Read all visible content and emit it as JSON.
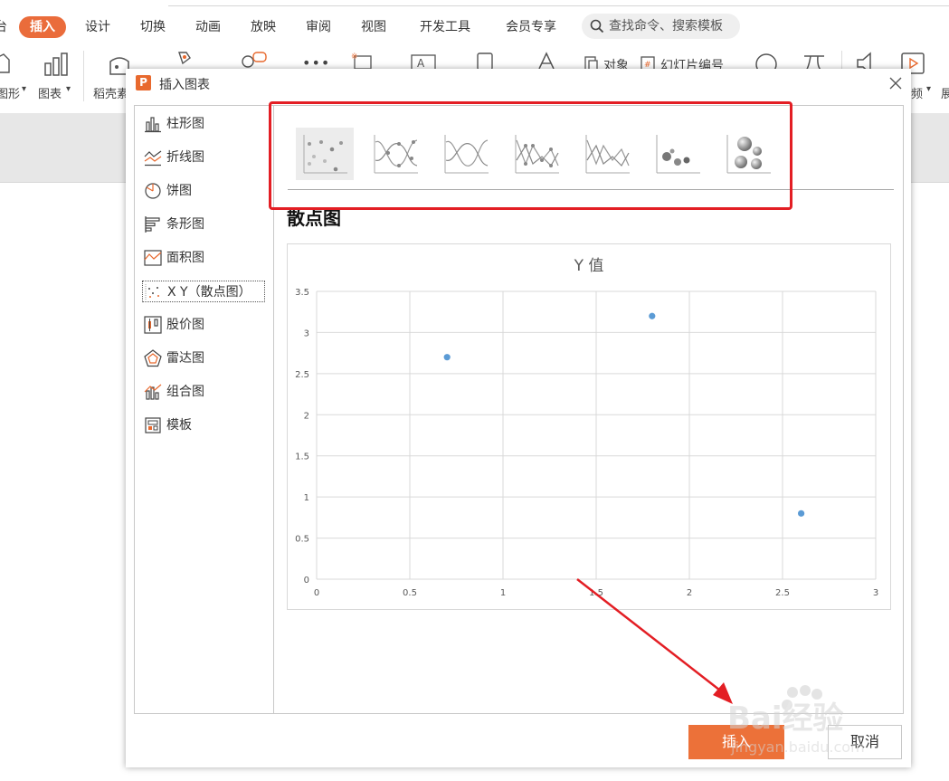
{
  "ribbon": {
    "tabs": [
      {
        "label": "插入",
        "active": true
      },
      {
        "label": "设计",
        "active": false
      },
      {
        "label": "切换",
        "active": false
      },
      {
        "label": "动画",
        "active": false
      },
      {
        "label": "放映",
        "active": false
      },
      {
        "label": "审阅",
        "active": false
      },
      {
        "label": "视图",
        "active": false
      },
      {
        "label": "开发工具",
        "active": false
      },
      {
        "label": "会员专享",
        "active": false
      }
    ],
    "search_placeholder": "查找命令、搜索模板",
    "buttons": {
      "shape": "图形",
      "chart": "图表",
      "daoke": "稻壳素",
      "object": "对象",
      "slide_number": "幻灯片编号",
      "video": "频",
      "more": "展"
    },
    "accent_color": "#ea6c3b"
  },
  "dialog": {
    "title": "插入图表",
    "logo_letter": "P",
    "sidebar": [
      {
        "label": "柱形图",
        "icon": "column-chart-icon",
        "selected": false
      },
      {
        "label": "折线图",
        "icon": "line-chart-icon",
        "selected": false
      },
      {
        "label": "饼图",
        "icon": "pie-chart-icon",
        "selected": false
      },
      {
        "label": "条形图",
        "icon": "bar-chart-icon",
        "selected": false
      },
      {
        "label": "面积图",
        "icon": "area-chart-icon",
        "selected": false
      },
      {
        "label": "X Y（散点图）",
        "icon": "scatter-chart-icon",
        "selected": true
      },
      {
        "label": "股价图",
        "icon": "stock-chart-icon",
        "selected": false
      },
      {
        "label": "雷达图",
        "icon": "radar-chart-icon",
        "selected": false
      },
      {
        "label": "组合图",
        "icon": "combo-chart-icon",
        "selected": false
      },
      {
        "label": "模板",
        "icon": "template-icon",
        "selected": false
      }
    ],
    "subtypes": [
      {
        "name": "scatter-subtype-icon",
        "selected": true
      },
      {
        "name": "scatter-smooth-markers-subtype-icon",
        "selected": false
      },
      {
        "name": "scatter-smooth-lines-subtype-icon",
        "selected": false
      },
      {
        "name": "scatter-straight-markers-subtype-icon",
        "selected": false
      },
      {
        "name": "scatter-straight-lines-subtype-icon",
        "selected": false
      },
      {
        "name": "bubble-subtype-icon",
        "selected": false
      },
      {
        "name": "bubble-3d-subtype-icon",
        "selected": false
      }
    ],
    "selected_chart_name": "散点图",
    "insert_label": "插入",
    "cancel_label": "取消"
  },
  "chart_data": {
    "type": "scatter",
    "title": "Y 值",
    "xlabel": "",
    "ylabel": "",
    "xlim": [
      0,
      3
    ],
    "ylim": [
      0,
      3.5
    ],
    "x_ticks": [
      "0",
      "0.5",
      "1",
      "1.5",
      "2",
      "2.5",
      "3"
    ],
    "y_ticks": [
      "0",
      "0.5",
      "1",
      "1.5",
      "2",
      "2.5",
      "3",
      "3.5"
    ],
    "grid": true,
    "legend": "none",
    "point_color": "#5b9bd5",
    "points": [
      {
        "x": 0.7,
        "y": 2.7
      },
      {
        "x": 1.8,
        "y": 3.2
      },
      {
        "x": 2.6,
        "y": 0.8
      }
    ]
  },
  "annotations": {
    "highlight_color": "#e31e24",
    "watermark_text": "Bai经验",
    "watermark_sub": "jingyan.baidu.com"
  }
}
